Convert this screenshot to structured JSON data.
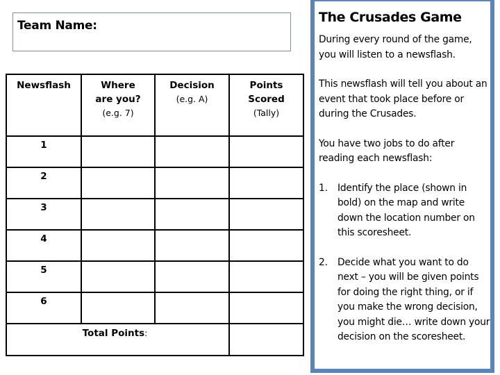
{
  "team": {
    "label": "Team Name:",
    "value": ""
  },
  "table": {
    "headers": [
      {
        "main": "Newsflash",
        "sub": ""
      },
      {
        "main": "Where are you?",
        "sub": "(e.g. 7)"
      },
      {
        "main": "Decision",
        "sub": "(e.g. A)"
      },
      {
        "main": "Points Scored",
        "sub": "(Tally)"
      }
    ],
    "rows": [
      {
        "num": "1",
        "where": "",
        "decision": "",
        "points": ""
      },
      {
        "num": "2",
        "where": "",
        "decision": "",
        "points": ""
      },
      {
        "num": "3",
        "where": "",
        "decision": "",
        "points": ""
      },
      {
        "num": "4",
        "where": "",
        "decision": "",
        "points": ""
      },
      {
        "num": "5",
        "where": "",
        "decision": "",
        "points": ""
      },
      {
        "num": "6",
        "where": "",
        "decision": "",
        "points": ""
      }
    ],
    "total_label": "Total Points",
    "total_colon": ":",
    "total_value": ""
  },
  "panel": {
    "title": "The Crusades Game",
    "paragraphs": [
      "During every round of the game, you will listen to a newsflash.",
      "This newsflash will tell you about an event that took place before or during the Crusades.",
      "You have two jobs to do after reading each newsflash:"
    ],
    "steps": [
      {
        "marker": "1.",
        "text": "Identify the place (shown in bold) on the map and write down the location number on this scoresheet."
      },
      {
        "marker": "2.",
        "text": "Decide what you want to do next – you will be given points for doing the right thing, or if you make the wrong decision, you might die… write down your decision on the scoresheet."
      }
    ],
    "border_color": "#5b85ba"
  }
}
